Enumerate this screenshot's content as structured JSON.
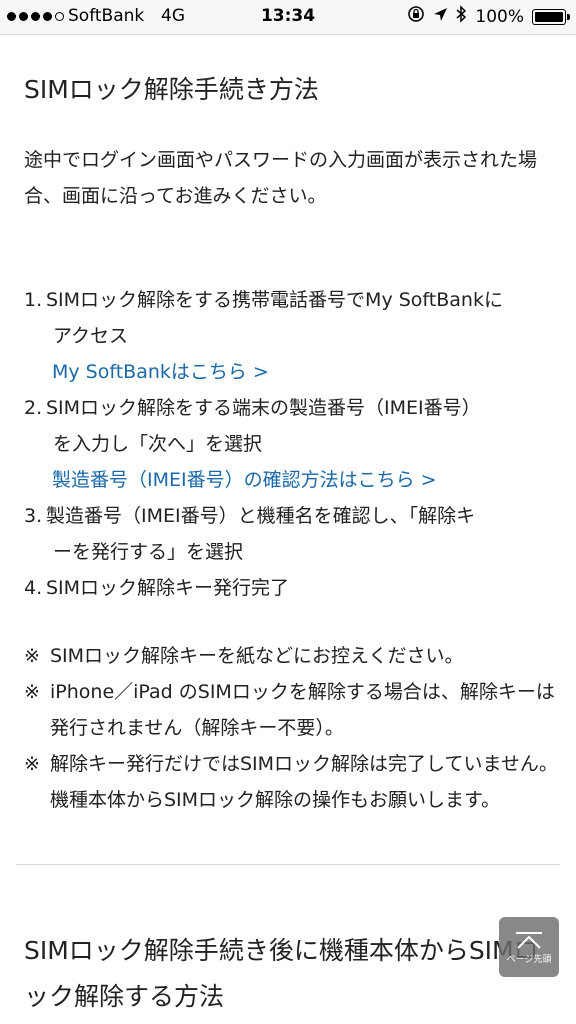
{
  "status_bar": {
    "carrier": "SoftBank",
    "network": "4G",
    "time": "13:34",
    "battery": "100%",
    "icons": [
      "orientation-lock-icon",
      "location-arrow-icon",
      "bluetooth-icon",
      "battery-icon"
    ]
  },
  "section1": {
    "title": "SIMロック解除手続き方法",
    "intro": "途中でログイン画面やパスワードの入力画面が表示された場合、画面に沿ってお進みください。",
    "steps": [
      {
        "num": "1.",
        "line1": "SIMロック解除をする携帯電話番号でMy SoftBankに",
        "line2": "アクセス",
        "link": "My SoftBankはこちら >"
      },
      {
        "num": "2.",
        "line1": "SIMロック解除をする端末の製造番号（IMEI番号）",
        "line2": "を入力し「次へ」を選択",
        "link": "製造番号（IMEI番号）の確認方法はこちら >"
      },
      {
        "num": "3.",
        "line1": "製造番号（IMEI番号）と機種名を確認し、「解除キ",
        "line2": "ーを発行する」を選択"
      },
      {
        "num": "4.",
        "line1": "SIMロック解除キー発行完了"
      }
    ],
    "notes": [
      {
        "mark": "※",
        "text": "SIMロック解除キーを紙などにお控えください。"
      },
      {
        "mark": "※",
        "text": "iPhone／iPad のSIMロックを解除する場合は、解除キーは発行されません（解除キー不要）。"
      },
      {
        "mark": "※",
        "text": "解除キー発行だけではSIMロック解除は完了していません。機種本体からSIMロック解除の操作もお願いします。"
      }
    ]
  },
  "section2": {
    "title": "SIMロック解除手続き後に機種本体からSIMロック解除する方法"
  },
  "page_top": {
    "label": "ページ先頭",
    "icon": "chevron-up-icon"
  },
  "colors": {
    "link": "#1a69a8",
    "text": "#222222",
    "status_bg": "#f7f7f7",
    "page_top_bg": "#6e6e6e"
  }
}
